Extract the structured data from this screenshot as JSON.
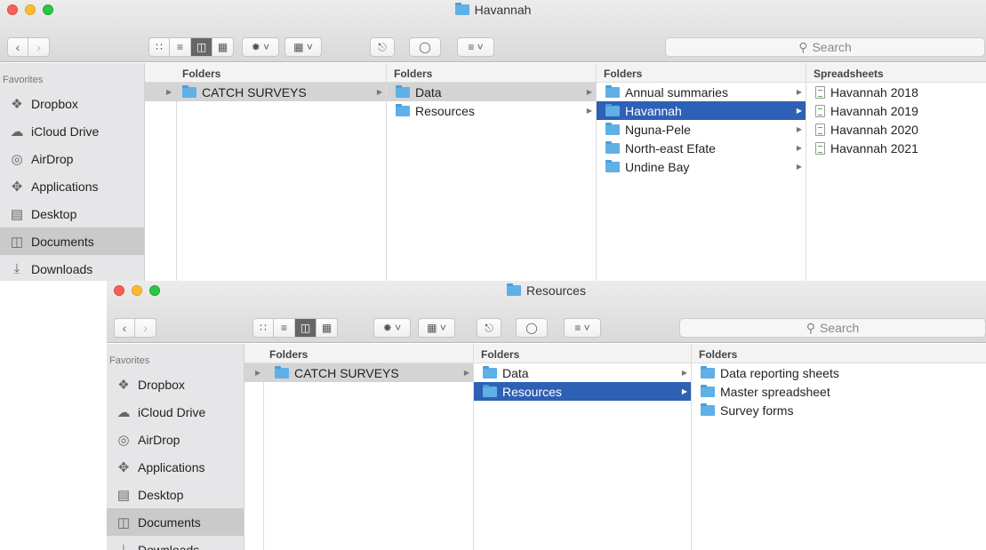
{
  "win1": {
    "title": "Havannah",
    "search_placeholder": "Search",
    "sidebar": {
      "heading": "Favorites",
      "items": [
        {
          "label": "Dropbox",
          "icon": "dropbox-icon",
          "selected": false
        },
        {
          "label": "iCloud Drive",
          "icon": "cloud-icon",
          "selected": false
        },
        {
          "label": "AirDrop",
          "icon": "airdrop-icon",
          "selected": false
        },
        {
          "label": "Applications",
          "icon": "applications-icon",
          "selected": false
        },
        {
          "label": "Desktop",
          "icon": "desktop-icon",
          "selected": false
        },
        {
          "label": "Documents",
          "icon": "documents-icon",
          "selected": true
        },
        {
          "label": "Downloads",
          "icon": "downloads-icon",
          "selected": false
        }
      ]
    },
    "columns": [
      {
        "header": "Folders",
        "rows": [
          {
            "label": "CATCH SURVEYS",
            "state": "grey"
          }
        ]
      },
      {
        "header": "Folders",
        "rows": [
          {
            "label": "Data",
            "state": "grey"
          },
          {
            "label": "Resources",
            "state": "none"
          }
        ]
      },
      {
        "header": "Folders",
        "rows": [
          {
            "label": "Annual summaries",
            "state": "none"
          },
          {
            "label": "Havannah",
            "state": "blue"
          },
          {
            "label": "Nguna-Pele",
            "state": "none"
          },
          {
            "label": "North-east Efate",
            "state": "none"
          },
          {
            "label": "Undine Bay",
            "state": "none"
          }
        ]
      },
      {
        "header": "Spreadsheets",
        "rows": [
          {
            "label": "Havannah 2018"
          },
          {
            "label": "Havannah 2019"
          },
          {
            "label": "Havannah 2020"
          },
          {
            "label": "Havannah 2021"
          }
        ]
      }
    ]
  },
  "win2": {
    "title": "Resources",
    "search_placeholder": "Search",
    "sidebar": {
      "heading": "Favorites",
      "items": [
        {
          "label": "Dropbox",
          "icon": "dropbox-icon",
          "selected": false
        },
        {
          "label": "iCloud Drive",
          "icon": "cloud-icon",
          "selected": false
        },
        {
          "label": "AirDrop",
          "icon": "airdrop-icon",
          "selected": false
        },
        {
          "label": "Applications",
          "icon": "applications-icon",
          "selected": false
        },
        {
          "label": "Desktop",
          "icon": "desktop-icon",
          "selected": false
        },
        {
          "label": "Documents",
          "icon": "documents-icon",
          "selected": true
        },
        {
          "label": "Downloads",
          "icon": "downloads-icon",
          "selected": false
        }
      ]
    },
    "columns": [
      {
        "header": "Folders",
        "rows": [
          {
            "label": "CATCH SURVEYS",
            "state": "grey"
          }
        ]
      },
      {
        "header": "Folders",
        "rows": [
          {
            "label": "Data",
            "state": "none"
          },
          {
            "label": "Resources",
            "state": "blue"
          }
        ]
      },
      {
        "header": "Folders",
        "rows": [
          {
            "label": "Data reporting sheets",
            "state": "none"
          },
          {
            "label": "Master spreadsheet",
            "state": "none"
          },
          {
            "label": "Survey forms",
            "state": "none"
          }
        ]
      }
    ]
  },
  "colors": {
    "selection_blue": "#2e60b5",
    "selection_grey": "#d4d4d4",
    "folder_blue": "#5fb0e6",
    "sidebar_bg": "#e6e6e8"
  }
}
